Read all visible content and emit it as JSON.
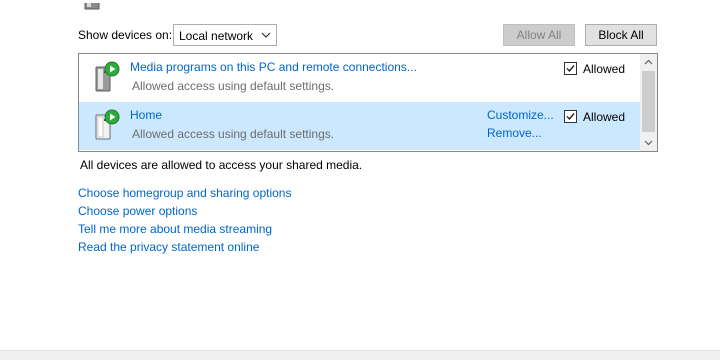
{
  "controls": {
    "show_devices_label": "Show devices on:",
    "network_select_value": "Local network",
    "allow_all_label": "Allow All",
    "block_all_label": "Block All"
  },
  "devices": [
    {
      "name": "Media programs on this PC and remote connections...",
      "status": "Allowed access using default settings.",
      "allowed_label": "Allowed",
      "allowed": true,
      "selected": false,
      "icon": "media-device-icon"
    },
    {
      "name": "Home",
      "status": "Allowed access using default settings.",
      "customize_label": "Customize...",
      "remove_label": "Remove...",
      "allowed_label": "Allowed",
      "allowed": true,
      "selected": true,
      "icon": "media-device-icon"
    }
  ],
  "status_text": "All devices are allowed to access your shared media.",
  "options": [
    "Choose homegroup and sharing options",
    "Choose power options",
    "Tell me more about media streaming",
    "Read the privacy statement online"
  ],
  "colors": {
    "link": "#0066cc",
    "selected_row": "#cce8ff",
    "play_badge": "#2eaa3c"
  }
}
